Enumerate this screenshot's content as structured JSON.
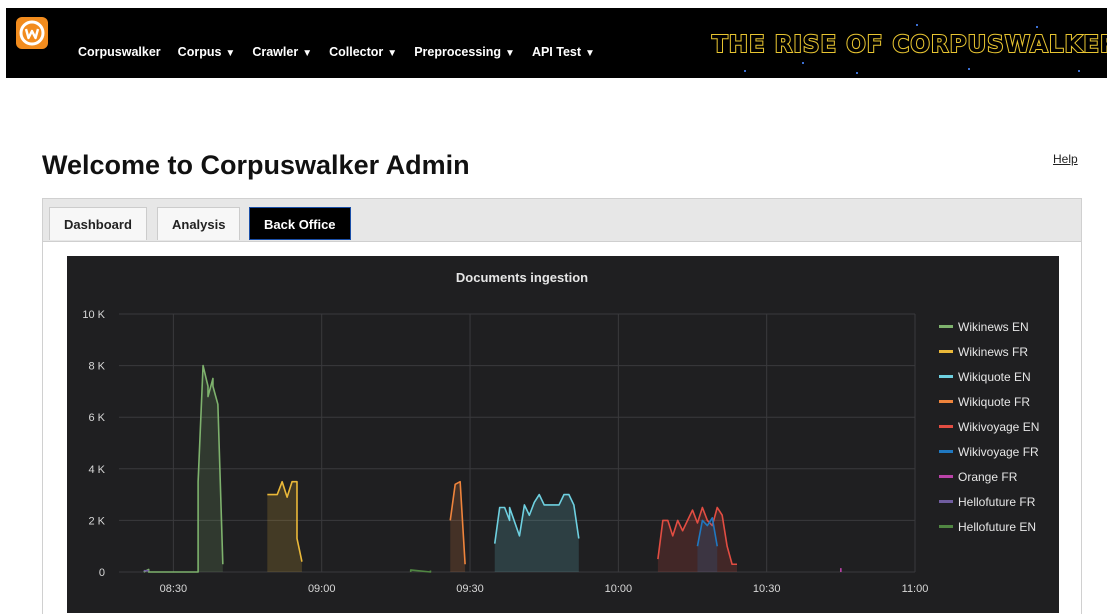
{
  "navbar": {
    "items": [
      {
        "label": "Corpuswalker",
        "caret": ""
      },
      {
        "label": "Corpus",
        "caret": "▼"
      },
      {
        "label": "Crawler",
        "caret": "▼"
      },
      {
        "label": "Collector",
        "caret": "▼"
      },
      {
        "label": "Preprocessing",
        "caret": "▼"
      },
      {
        "label": "API Test",
        "caret": "▼"
      }
    ],
    "banner_text": "THE RISE OF CORPUSWALKER"
  },
  "page": {
    "title": "Welcome to Corpuswalker Admin",
    "help_label": "Help"
  },
  "tabs": [
    {
      "label": "Dashboard",
      "active": false
    },
    {
      "label": "Analysis",
      "active": false
    },
    {
      "label": "Back Office",
      "active": true
    }
  ],
  "chart_data": {
    "type": "area",
    "title": "Documents ingestion",
    "xlabel": "",
    "ylabel": "",
    "ylim": [
      0,
      10000
    ],
    "yticks": [
      "0",
      "2 K",
      "4 K",
      "6 K",
      "8 K",
      "10 K"
    ],
    "xticks": [
      "08:30",
      "09:00",
      "09:30",
      "10:00",
      "10:30",
      "11:00"
    ],
    "xlim": [
      "08:19",
      "11:00"
    ],
    "grid": true,
    "legend_position": "right",
    "series": [
      {
        "name": "Wikinews EN",
        "color": "#7eb26d",
        "x": [
          "08:24",
          "08:25",
          "08:25",
          "08:26",
          "08:35",
          "08:35",
          "08:36",
          "08:37",
          "08:37",
          "08:38",
          "08:38",
          "08:39",
          "08:40"
        ],
        "y": [
          0,
          100,
          0,
          0,
          0,
          3500,
          8000,
          7200,
          6800,
          7500,
          7200,
          6500,
          300
        ]
      },
      {
        "name": "Wikinews FR",
        "color": "#eab839",
        "x": [
          "08:49",
          "08:50",
          "08:51",
          "08:52",
          "08:53",
          "08:54",
          "08:55",
          "08:55",
          "08:56"
        ],
        "y": [
          3000,
          3000,
          3000,
          3500,
          2900,
          3500,
          3500,
          1300,
          400
        ]
      },
      {
        "name": "Wikiquote EN",
        "color": "#6ed0e0",
        "x": [
          "09:35",
          "09:36",
          "09:37",
          "09:38",
          "09:38",
          "09:40",
          "09:41",
          "09:42",
          "09:43",
          "09:44",
          "09:45",
          "09:47",
          "09:48",
          "09:49",
          "09:50",
          "09:51",
          "09:52"
        ],
        "y": [
          1100,
          2500,
          2500,
          2000,
          2500,
          1400,
          2600,
          2200,
          2700,
          3000,
          2600,
          2600,
          2600,
          3000,
          3000,
          2600,
          1300
        ]
      },
      {
        "name": "Wikiquote FR",
        "color": "#ef843c",
        "x": [
          "09:26",
          "09:27",
          "09:28",
          "09:29"
        ],
        "y": [
          2000,
          3400,
          3500,
          300
        ]
      },
      {
        "name": "Wikivoyage EN",
        "color": "#e24d42",
        "x": [
          "10:08",
          "10:09",
          "10:10",
          "10:11",
          "10:12",
          "10:13",
          "10:14",
          "10:15",
          "10:16",
          "10:17",
          "10:18",
          "10:19",
          "10:20",
          "10:21",
          "10:22",
          "10:23",
          "10:24"
        ],
        "y": [
          500,
          2000,
          2000,
          1400,
          2000,
          1600,
          2000,
          2400,
          1900,
          2500,
          2000,
          1800,
          2500,
          2200,
          1000,
          300,
          300
        ]
      },
      {
        "name": "Wikivoyage FR",
        "color": "#1f78c1",
        "x": [
          "10:16",
          "10:17",
          "10:18",
          "10:19",
          "10:20"
        ],
        "y": [
          1000,
          2000,
          1800,
          2100,
          1000
        ]
      },
      {
        "name": "Orange FR",
        "color": "#ba43a9",
        "x": [
          "10:45",
          "10:45"
        ],
        "y": [
          0,
          150
        ]
      },
      {
        "name": "Hellofuture FR",
        "color": "#705da0",
        "x": [
          "08:24",
          "08:25"
        ],
        "y": [
          50,
          50
        ]
      },
      {
        "name": "Hellofuture EN",
        "color": "#508642",
        "x": [
          "09:18",
          "09:18",
          "09:22",
          "09:22"
        ],
        "y": [
          0,
          80,
          0,
          60
        ]
      }
    ]
  }
}
